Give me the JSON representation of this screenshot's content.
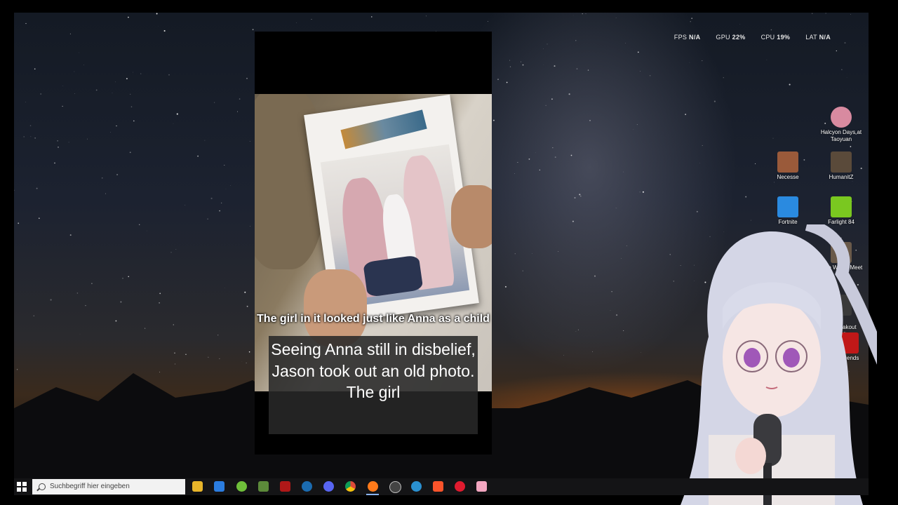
{
  "hud": {
    "fps_label": "FPS",
    "fps_value": "N/A",
    "gpu_label": "GPU",
    "gpu_value": "22%",
    "cpu_label": "CPU",
    "cpu_value": "19%",
    "lat_label": "LAT",
    "lat_value": "N/A"
  },
  "desktop_icons": [
    {
      "label": "Halcyon Days at Taoyuan",
      "icon": "game-icon-flower",
      "color": "#d88aa0"
    },
    {
      "label": "Necesse",
      "icon": "game-icon-necesse",
      "color": "#9a5a3a"
    },
    {
      "label": "HumanitZ",
      "icon": "game-icon-humanitz",
      "color": "#5a4a3a"
    },
    {
      "label": "Fortnite",
      "icon": "game-icon-fortnite",
      "color": "#2a8ae0"
    },
    {
      "label": "Farlight 84",
      "icon": "game-icon-farlight",
      "color": "#7ac820"
    },
    {
      "label": "here Winds Meet",
      "icon": "game-icon-winds",
      "color": "#6a5a4a"
    },
    {
      "label": "na Breakout\nInfinite",
      "icon": "game-icon-arena",
      "color": "#3a3a3a"
    },
    {
      "label": "Legends",
      "icon": "game-icon-apex",
      "color": "#c01818"
    }
  ],
  "video": {
    "small_subtitle": "The girl in it looked just like Anna as a child",
    "caption": "Seeing Anna still in disbelief, Jason took out an old photo. The girl"
  },
  "taskbar": {
    "search_placeholder": "Suchbegriff hier eingeben",
    "apps": [
      {
        "name": "file-explorer-icon",
        "color": "#e8b52a"
      },
      {
        "name": "store-icon",
        "color": "#2b7de0"
      },
      {
        "name": "android-icon",
        "color": "#6fbf3a"
      },
      {
        "name": "minecraft-icon",
        "color": "#5c8a3a"
      },
      {
        "name": "media-app-icon",
        "color": "#b01818"
      },
      {
        "name": "steam-icon",
        "color": "#1b6bb0"
      },
      {
        "name": "discord-icon",
        "color": "#5865f2"
      },
      {
        "name": "chrome-icon",
        "color": "#dd4b39"
      },
      {
        "name": "firefox-icon",
        "color": "#ff7a1a"
      },
      {
        "name": "obs-icon",
        "color": "#444444"
      },
      {
        "name": "app-blue-icon",
        "color": "#2a90d0"
      },
      {
        "name": "brave-icon",
        "color": "#fb542b"
      },
      {
        "name": "opera-icon",
        "color": "#e01b2f"
      },
      {
        "name": "pink-app-icon",
        "color": "#f3a6c0"
      }
    ]
  }
}
